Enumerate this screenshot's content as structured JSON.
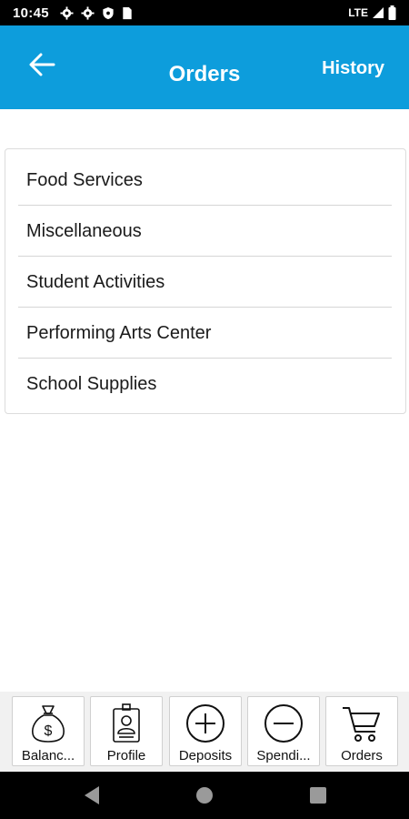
{
  "status_bar": {
    "time": "10:45",
    "network": "LTE",
    "icons_left": [
      "gear-icon",
      "gear-icon",
      "shield-icon",
      "sim-card-icon"
    ],
    "icons_right": [
      "signal-icon",
      "battery-icon"
    ]
  },
  "header": {
    "back_icon": "arrow-left-icon",
    "title": "Orders",
    "history_label": "History",
    "background_color": "#0d9ddc"
  },
  "order_categories": [
    {
      "label": "Food Services"
    },
    {
      "label": "Miscellaneous"
    },
    {
      "label": "Student Activities"
    },
    {
      "label": "Performing Arts Center"
    },
    {
      "label": "School Supplies"
    }
  ],
  "bottom_nav": [
    {
      "label": "Balanc...",
      "icon": "money-bag-icon"
    },
    {
      "label": "Profile",
      "icon": "id-badge-icon"
    },
    {
      "label": "Deposits",
      "icon": "plus-circle-icon"
    },
    {
      "label": "Spendi...",
      "icon": "minus-circle-icon"
    },
    {
      "label": "Orders",
      "icon": "cart-icon"
    }
  ],
  "system_nav": [
    "back-triangle-icon",
    "home-circle-icon",
    "recents-square-icon"
  ]
}
